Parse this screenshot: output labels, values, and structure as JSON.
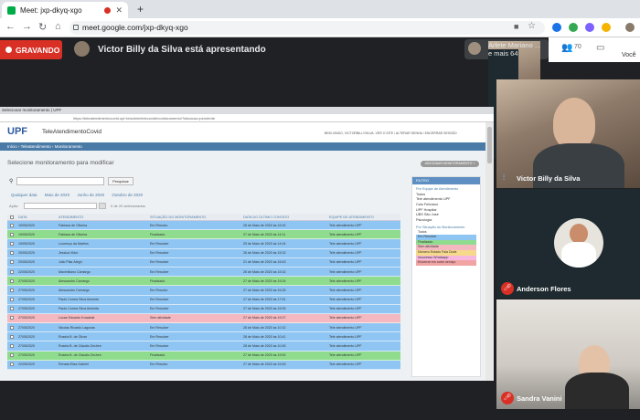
{
  "browser": {
    "tab_title": "Meet: jxp-dkyq-xgo",
    "url": "meet.google.com/jxp-dkyq-xgo"
  },
  "meet": {
    "recording_label": "GRAVANDO",
    "presenting_text": "Victor Billy da Silva está apresentando",
    "participants_line1": "Arlete Mariano ...",
    "participants_line2": "e mais 64",
    "participant_count": "70",
    "panel_label": "Você"
  },
  "shared": {
    "tab_title": "Selecionar monitoramento | UPF",
    "address": "https://teleatendimentocovid.upf.br/admin/telecovid/monitoramento/?situacao=pendente",
    "logo": "UPF",
    "app_name": "TeleAtendimentoCovid",
    "user_info": "BEM-VINDO, VICTORBILLYSILVA. VER O SITE / ALTERAR SENHA / ENCERRAR SESSÃO",
    "breadcrumb": "Início › Teleatendimento › Monitoramento",
    "page_title": "Selecione monitoramento para modificar",
    "add_button": "ADICIONAR MONITORAMENTO +",
    "search_button": "Pesquisar",
    "date_filters": [
      "Qualquer data",
      "Maio de 2020",
      "Junho de 2020",
      "Outubro de 2020"
    ],
    "action_label": "Ação:",
    "selected_count": "0 de 20 selecionados",
    "columns": [
      "DATA",
      "ATENDIMENTO",
      "SITUAÇÃO DO MONITORAMENTO",
      "DATA DO ÚLTIMO CONTATO",
      "EQUIPE DE ATENDIMENTO"
    ],
    "rows": [
      {
        "date": "19/05/2020",
        "name": "Fabiana de Oliveira",
        "status": "Em Resolvo",
        "last": "26 de Maio de 2020 às 15:32",
        "team": "Tele atendimento UPF",
        "color": "#8fc5f2"
      },
      {
        "date": "19/05/2020",
        "name": "Fabiana de Oliveira",
        "status": "Finalizado",
        "last": "27 de Maio de 2020 às 14:11",
        "team": "Tele atendimento UPF",
        "color": "#8fdc8f"
      },
      {
        "date": "19/05/2020",
        "name": "Lourenço da Martins",
        "status": "Em Resolver",
        "last": "25 de Maio de 2020 às 14:04",
        "team": "Tele atendimento UPF",
        "color": "#8fc5f2"
      },
      {
        "date": "20/05/2020",
        "name": "Jessica Vidor",
        "status": "Em Resolver",
        "last": "26 de Maio de 2020 às 15:32",
        "team": "Tele atendimento UPF",
        "color": "#8fc5f2"
      },
      {
        "date": "20/05/2020",
        "name": "Julio Pilar Alegri",
        "status": "Em Resolver",
        "last": "21 de Maio de 2020 às 15:43",
        "team": "Tele atendimento UPF",
        "color": "#8fc5f2"
      },
      {
        "date": "22/05/2020",
        "name": "Maximiliano Camargo",
        "status": "Em Resolver",
        "last": "26 de Maio de 2020 às 15:32",
        "team": "Tele atendimento UPF",
        "color": "#8fc5f2"
      },
      {
        "date": "27/05/2020",
        "name": "Alessandro Camargo",
        "status": "Finalizado",
        "last": "27 de Maio de 2020 às 19:24",
        "team": "Tele atendimento UPF",
        "color": "#8fdc8f"
      },
      {
        "date": "27/05/2020",
        "name": "Alessandro Camargo",
        "status": "Em Resolvo",
        "last": "27 de Maio de 2020 às 16:26",
        "team": "Tele atendimento UPF",
        "color": "#8fc5f2"
      },
      {
        "date": "27/05/2020",
        "name": "Paulo Correa Silva Almeida",
        "status": "Em Resolver",
        "last": "27 de Maio de 2020 às 17:51",
        "team": "Tele atendimento UPF",
        "color": "#8fc5f2"
      },
      {
        "date": "27/05/2020",
        "name": "Paulo Correa Silva Almeida",
        "status": "Em Resolver",
        "last": "27 de Maio de 2020 às 15:05",
        "team": "Tele atendimento UPF",
        "color": "#8fc5f2"
      },
      {
        "date": "27/05/2020",
        "name": "Lucas Eduardo Kowalski",
        "status": "Sem atividade",
        "last": "27 de Maio de 2020 às 19:27",
        "team": "Tele atendimento UPF",
        "color": "#f4b8c0"
      },
      {
        "date": "27/05/2020",
        "name": "Nicolas Ricardo Lagunas",
        "status": "Em Resolver",
        "last": "28 de Maio de 2020 às 10:32",
        "team": "Tele atendimento UPF",
        "color": "#8fc5f2"
      },
      {
        "date": "27/05/2020",
        "name": "Rosela B. de Olivar",
        "status": "Em Resolver",
        "last": "28 de Maio de 2020 às 10:41",
        "team": "Tele atendimento UPF",
        "color": "#8fc5f2"
      },
      {
        "date": "27/05/2020",
        "name": "Rosela B. de Cláudio Zechen",
        "status": "Em Resolver",
        "last": "28 de Maio de 2020 às 10:45",
        "team": "Tele atendimento UPF",
        "color": "#8fc5f2"
      },
      {
        "date": "27/05/2020",
        "name": "Rosela B. de Cláudio Zechen",
        "status": "Finalizado",
        "last": "27 de Maio de 2020 às 19:52",
        "team": "Tele atendimento UPF",
        "color": "#8fdc8f"
      },
      {
        "date": "22/05/2020",
        "name": "Renata Eliza Gabriel",
        "status": "Em Resolvo",
        "last": "27 de Maio de 2020 às 15:45",
        "team": "Tele atendimento UPF",
        "color": "#8fc5f2"
      }
    ],
    "filter_header": "FILTRO",
    "filter_group1_title": "Por Equipe de Atendimento",
    "filter_group1": [
      "Todos",
      "Tele atendimento UPF",
      "Caio Feliciano",
      "UPF Hospital",
      "UBS São José",
      "Psicologia"
    ],
    "filter_group2_title": "Por Situação do Monitoramento",
    "filter_group2": [
      {
        "label": "Todos",
        "color": "#ffffff"
      },
      {
        "label": "Em Resolver",
        "color": "#8fc5f2"
      },
      {
        "label": "Finalizado",
        "color": "#8fdc8f"
      },
      {
        "label": "Sem atividade",
        "color": "#f4b8c0"
      },
      {
        "label": "Número Estado Fala Dode",
        "color": "#f6d98a"
      },
      {
        "label": "Insucesso Whatsapp",
        "color": "#f7b8e0"
      },
      {
        "label": "Encerrar em outro serviço",
        "color": "#f2a3a3"
      }
    ]
  },
  "participants": [
    {
      "name": "Victor Billy da Silva",
      "speaking": true
    },
    {
      "name": "Anderson Flores",
      "muted": true
    },
    {
      "name": "Sandra Vanini",
      "muted": true
    }
  ]
}
